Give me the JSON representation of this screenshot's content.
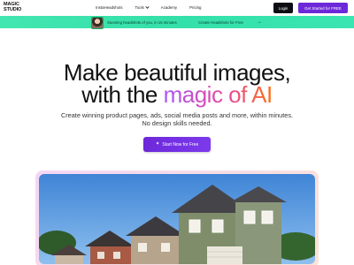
{
  "header": {
    "logo_line1": "MAGIC",
    "logo_line2": "STUDIO",
    "nav": [
      {
        "label": "InstaHeadshots",
        "has_dropdown": false
      },
      {
        "label": "Tools",
        "has_dropdown": true
      },
      {
        "label": "Academy",
        "has_dropdown": false
      },
      {
        "label": "Pricing",
        "has_dropdown": false
      }
    ],
    "login_label": "Login",
    "cta_label": "Get Started for FREE"
  },
  "banner": {
    "text": "Stunning headshots of you, in 15 minutes",
    "link_text": "Create Headshots for Free",
    "arrow_icon": "arrow-right-icon",
    "color": "#3be3ad"
  },
  "hero": {
    "title_line1": "Make beautiful images,",
    "title_line2_plain": "with the ",
    "title_line2_accent": "magic of AI",
    "subtitle_line1": "Create winning product pages, ads, social media posts and more, within minutes.",
    "subtitle_line2": "No design skills needed.",
    "button_label": "Start Now for Free",
    "button_icon": "sparkle-icon",
    "accent_color": "#6d28d9"
  },
  "showcase": {
    "image_subject": "suburban-houses-photo"
  }
}
